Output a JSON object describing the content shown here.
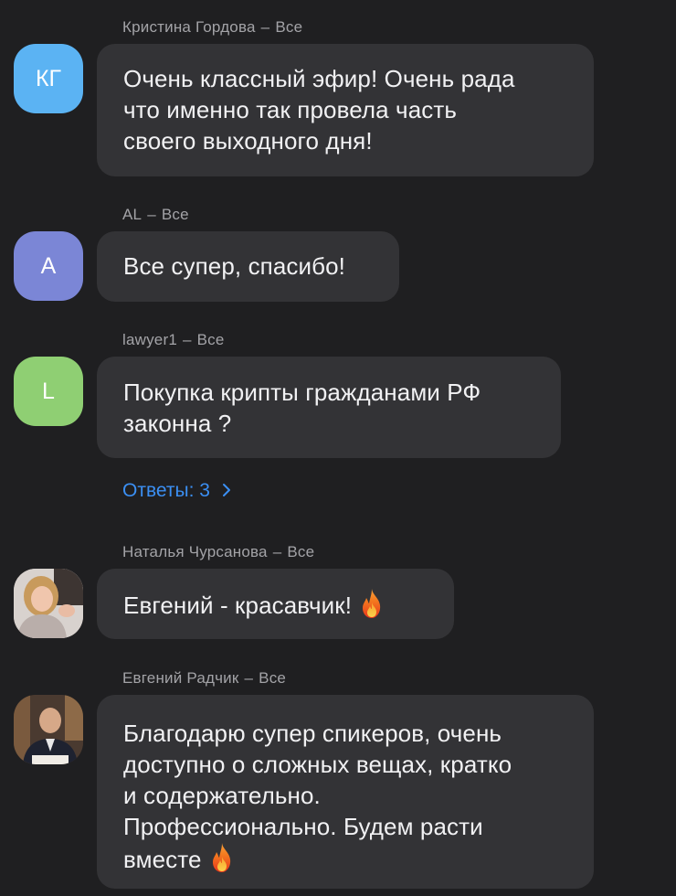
{
  "colors": {
    "background": "#1f1f21",
    "bubble": "#333336",
    "meta_text": "#a3a3a7",
    "message_text": "#f1f1f3",
    "link": "#3b8ff3",
    "avatar_kg": "#5bb3f3",
    "avatar_a": "#7b86d6",
    "avatar_l": "#8fcf73"
  },
  "messages": [
    {
      "author": "Кристина Гордова",
      "audience": "Все",
      "avatar_initials": "КГ",
      "lines": [
        "Очень классный эфир! Очень рада",
        "что именно так провела часть",
        "своего выходного дня!"
      ]
    },
    {
      "author": "AL",
      "audience": "Все",
      "avatar_initials": "A",
      "lines": [
        "Все супер, спасибо!"
      ]
    },
    {
      "author": "lawyer1",
      "audience": "Все",
      "avatar_initials": "L",
      "lines": [
        "Покупка крипты гражданами РФ",
        "законна ?"
      ]
    },
    {
      "author": "Наталья Чурсанова",
      "audience": "Все",
      "avatar_icon": "user-photo",
      "lines": [
        "Евгений - красавчик!"
      ],
      "trailing_icon": "fire-emoji"
    },
    {
      "author": "Евгений Радчик",
      "audience": "Все",
      "avatar_icon": "user-photo",
      "lines": [
        "Благодарю супер спикеров, очень",
        "доступно о сложных вещах, кратко",
        "и содержательно.",
        "Профессионально. Будем расти",
        "вместе"
      ],
      "trailing_icon": "fire-emoji"
    }
  ],
  "replies": {
    "label": "Ответы: 3",
    "icon": "chevron-right-icon"
  }
}
